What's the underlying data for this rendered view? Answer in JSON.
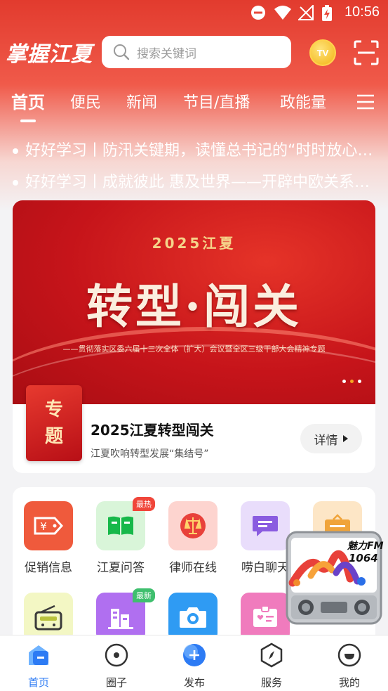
{
  "status_bar": {
    "time": "10:56"
  },
  "header": {
    "brand": "掌握江夏",
    "search_placeholder": "搜索关键词",
    "tv_label": "TV",
    "search_icon": "search-icon",
    "scan_icon": "scan-icon"
  },
  "tabs": [
    {
      "label": "首页",
      "active": true
    },
    {
      "label": "便民",
      "active": false
    },
    {
      "label": "新闻",
      "active": false
    },
    {
      "label": "节目/直播",
      "active": false
    },
    {
      "label": "政能量",
      "active": false
    }
  ],
  "ticker": [
    "好好学习丨防汛关键期，读懂总书记的“时时放心不下”",
    "好好学习丨成就彼此 惠及世界——开辟中欧关系新未来"
  ],
  "banner": {
    "year_line": "2025江夏",
    "headline": "转型·闯关",
    "subtitle": "——贯彻落实区委六届十三次全体（扩大）会议暨全区三级干部大会精神专题",
    "page_count": 3,
    "active_index": 1
  },
  "topic": {
    "badge_line1": "专",
    "badge_line2": "题",
    "title": "2025江夏转型闯关",
    "description": "江夏吹响转型发展“集结号”",
    "detail_label": "详情"
  },
  "services": [
    {
      "label": "促销信息",
      "icon": "price-tag-icon",
      "color": "#ef5a3c",
      "bg": "#ef5a3c",
      "tag": ""
    },
    {
      "label": "江夏问答",
      "icon": "book-icon",
      "color": "#17b84a",
      "bg": "#d9f5d9",
      "tag": "最热",
      "tag_color": "#f0463a"
    },
    {
      "label": "律师在线",
      "icon": "scales-icon",
      "color": "#e8413a",
      "bg": "#fdd4cf",
      "tag": ""
    },
    {
      "label": "唠白聊天",
      "icon": "chat-icon",
      "color": "#8a5ce0",
      "bg": "#e9ddfb",
      "tag": ""
    },
    {
      "label": "",
      "icon": "board-icon",
      "color": "#f0a43a",
      "bg": "#fde6c6",
      "tag": ""
    },
    {
      "label": "",
      "icon": "radio-icon",
      "color": "#b9c23c",
      "bg": "#f3f7c4",
      "tag": ""
    },
    {
      "label": "",
      "icon": "building-icon",
      "color": "#9b55df",
      "bg": "#b06ff0",
      "tag": "最新",
      "tag_color": "#3fbf6e"
    },
    {
      "label": "",
      "icon": "camera-icon",
      "color": "#2a8ff0",
      "bg": "#2f9bf3",
      "tag": ""
    },
    {
      "label": "",
      "icon": "id-card-icon",
      "color": "#e05aa8",
      "bg": "#f07bbd",
      "tag": ""
    }
  ],
  "radio_widget": {
    "brand": "魅力FM",
    "frequency": "1064"
  },
  "bottom_nav": [
    {
      "label": "首页",
      "icon": "home-icon",
      "active": true
    },
    {
      "label": "圈子",
      "icon": "circle-icon",
      "active": false
    },
    {
      "label": "发布",
      "icon": "plus-icon",
      "active": false
    },
    {
      "label": "服务",
      "icon": "compass-icon",
      "active": false
    },
    {
      "label": "我的",
      "icon": "profile-icon",
      "active": false
    }
  ],
  "colors": {
    "brand_red": "#e23b2e",
    "nav_active": "#2d7bf4"
  }
}
